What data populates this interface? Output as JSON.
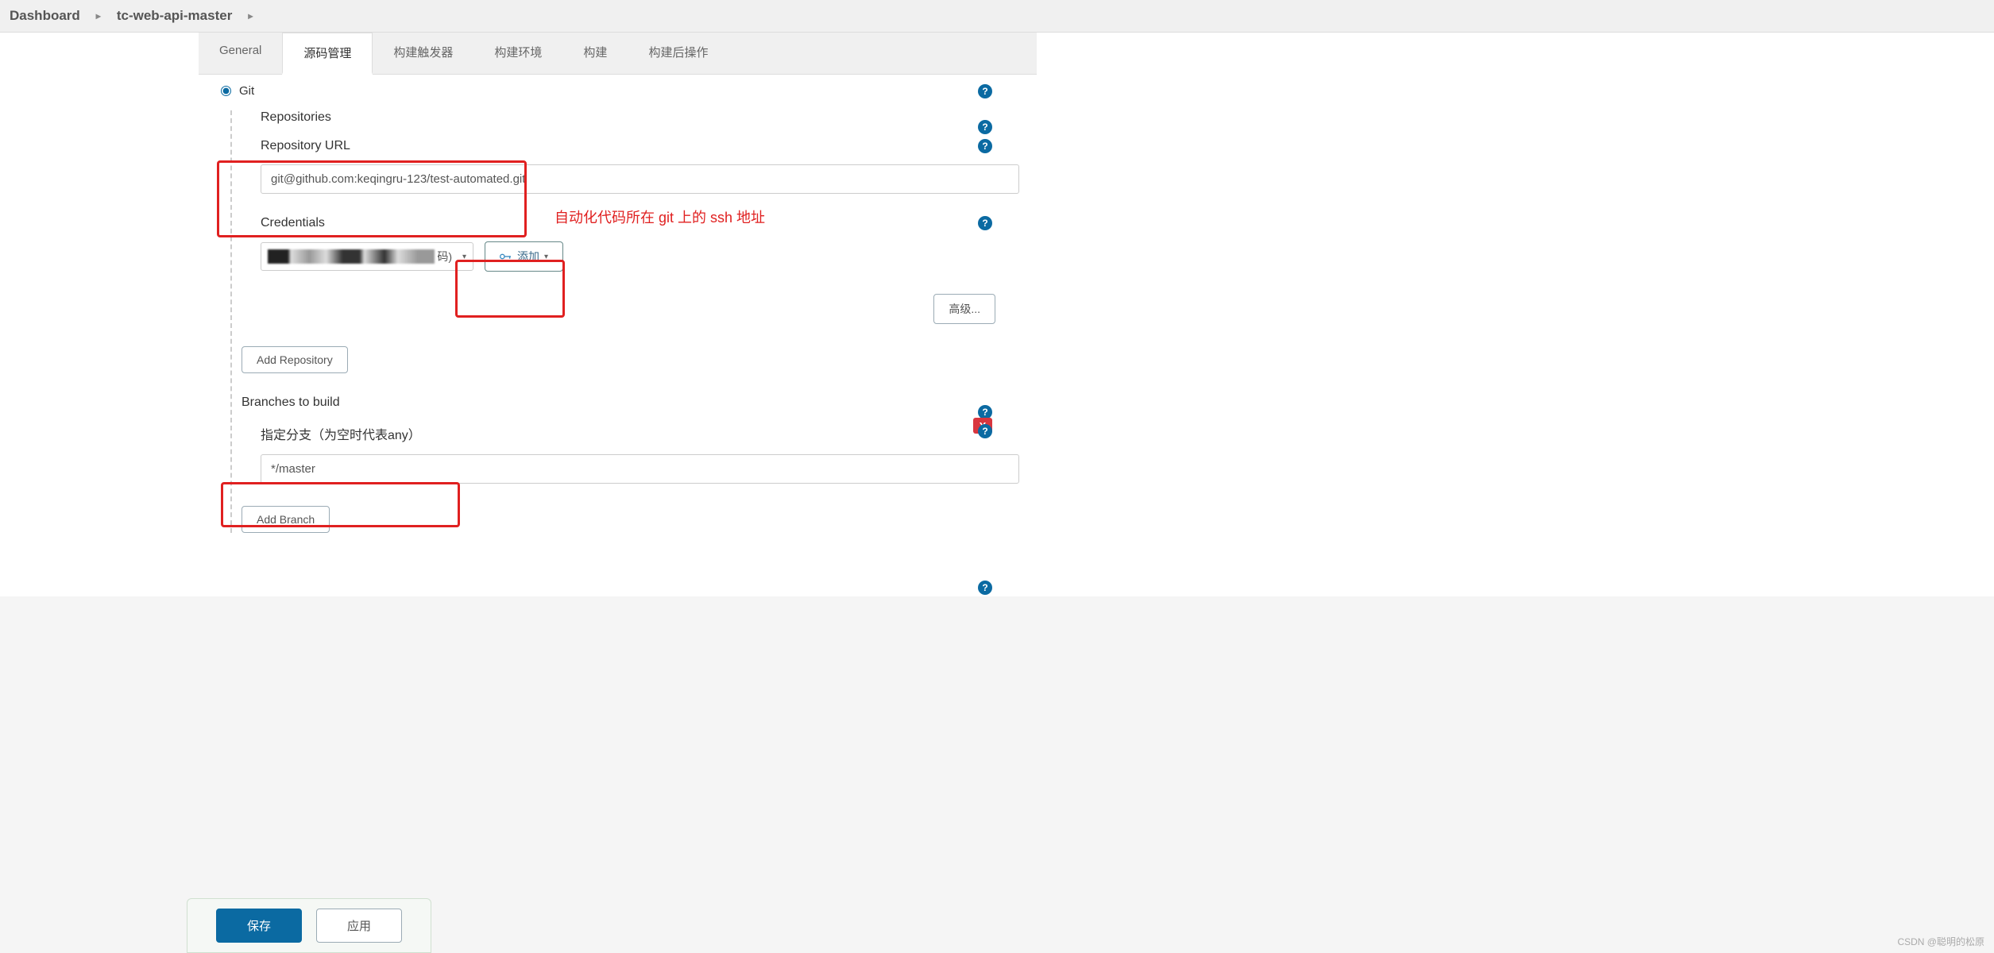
{
  "breadcrumb": {
    "item1": "Dashboard",
    "item2": "tc-web-api-master"
  },
  "tabs": {
    "general": "General",
    "scm": "源码管理",
    "triggers": "构建触发器",
    "env": "构建环境",
    "build": "构建",
    "post": "构建后操作"
  },
  "scm": {
    "git_label": "Git",
    "repositories_label": "Repositories",
    "repo_url_label": "Repository URL",
    "repo_url_value": "git@github.com:keqingru-123/test-automated.git",
    "credentials_label": "Credentials",
    "cred_suffix": "码)",
    "add_cred_label": "添加",
    "advanced_label": "高级...",
    "add_repo_label": "Add Repository",
    "branches_label": "Branches to build",
    "branch_spec_label": "指定分支（为空时代表any）",
    "branch_spec_value": "*/master",
    "add_branch_label": "Add Branch",
    "delete_badge": "X"
  },
  "annotation": {
    "ssh_note": "自动化代码所在 git 上的 ssh 地址"
  },
  "footer": {
    "save": "保存",
    "apply": "应用"
  },
  "watermark": "CSDN @聪明的松原",
  "icons": {
    "help": "?",
    "chevron": "▸",
    "caret_down": "▾"
  }
}
